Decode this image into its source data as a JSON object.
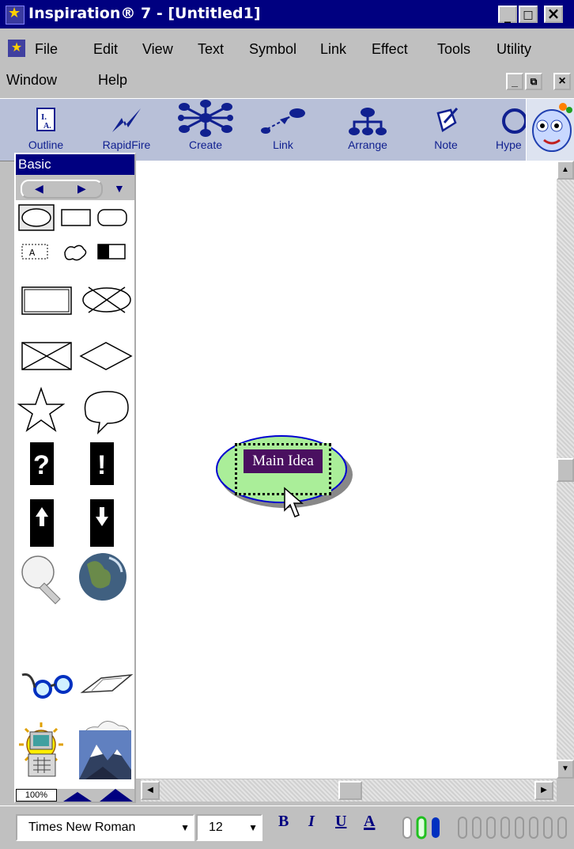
{
  "window": {
    "title": "Inspiration® 7 - [Untitled1]",
    "minimize": "_",
    "maximize": "□",
    "close": "×"
  },
  "menu": {
    "items": [
      "File",
      "Edit",
      "View",
      "Text",
      "Symbol",
      "Link",
      "Effect",
      "Tools",
      "Utility"
    ],
    "items2": [
      "Window",
      "Help"
    ]
  },
  "toolbar": {
    "tools": [
      "Outline",
      "RapidFire",
      "Create",
      "Link",
      "Arrange",
      "Note",
      "Hype"
    ]
  },
  "palette": {
    "title": "Basic",
    "zoom": "100%"
  },
  "canvas": {
    "node_text": "Main Idea"
  },
  "format": {
    "font": "Times New Roman",
    "size": "12",
    "bold": "B",
    "italic": "I",
    "underline": "U",
    "color": "A"
  }
}
